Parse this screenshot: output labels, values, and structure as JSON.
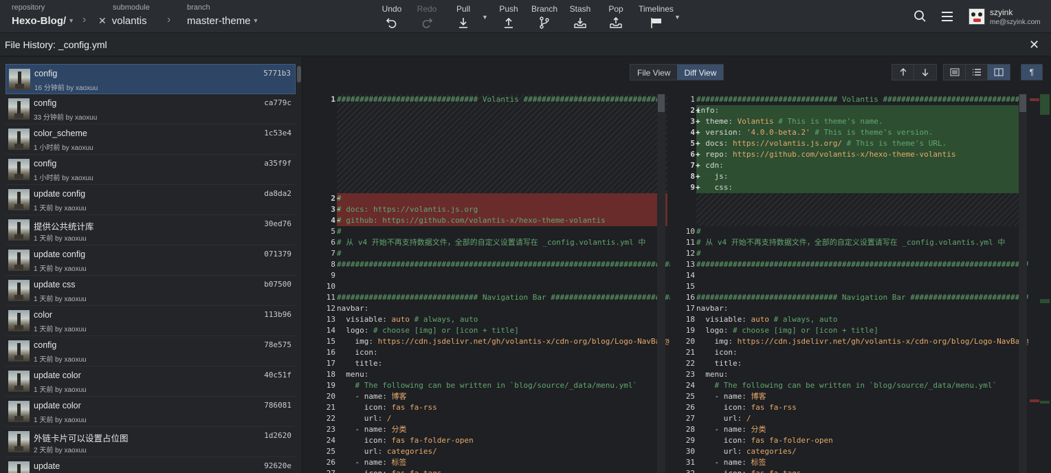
{
  "toolbar": {
    "repository": {
      "label": "repository",
      "value": "Hexo-Blog/"
    },
    "submodule": {
      "label": "submodule",
      "value": "volantis"
    },
    "branch": {
      "label": "branch",
      "value": "master-theme"
    },
    "actions": {
      "undo": "Undo",
      "redo": "Redo",
      "pull": "Pull",
      "push": "Push",
      "branch": "Branch",
      "stash": "Stash",
      "pop": "Pop",
      "timelines": "Timelines"
    },
    "user": {
      "name": "szyink",
      "email": "me@szyink.com"
    }
  },
  "file_history": {
    "title": "File History: _config.yml",
    "close_icon": "close-icon"
  },
  "commits": [
    {
      "message": "config",
      "meta": "16 分钟前 by xaoxuu",
      "sha": "5771b3",
      "selected": true
    },
    {
      "message": "config",
      "meta": "33 分钟前 by xaoxuu",
      "sha": "ca779c"
    },
    {
      "message": "color_scheme",
      "meta": "1 小时前 by xaoxuu",
      "sha": "1c53e4"
    },
    {
      "message": "config",
      "meta": "1 小时前 by xaoxuu",
      "sha": "a35f9f"
    },
    {
      "message": "update config",
      "meta": "1 天前 by xaoxuu",
      "sha": "da8da2"
    },
    {
      "message": "提供公共统计库",
      "meta": "1 天前 by xaoxuu",
      "sha": "30ed76"
    },
    {
      "message": "update config",
      "meta": "1 天前 by xaoxuu",
      "sha": "071379"
    },
    {
      "message": "update css",
      "meta": "1 天前 by xaoxuu",
      "sha": "b07500"
    },
    {
      "message": "color",
      "meta": "1 天前 by xaoxuu",
      "sha": "113b96"
    },
    {
      "message": "config",
      "meta": "1 天前 by xaoxuu",
      "sha": "78e575"
    },
    {
      "message": "update color",
      "meta": "1 天前 by xaoxuu",
      "sha": "40c51f"
    },
    {
      "message": "update color",
      "meta": "1 天前 by xaoxuu",
      "sha": "786081"
    },
    {
      "message": "外链卡片可以设置占位图",
      "meta": "2 天前 by xaoxuu",
      "sha": "1d2620"
    },
    {
      "message": "update",
      "meta": "",
      "sha": "92620e"
    }
  ],
  "diff": {
    "view_toggle": {
      "file_view": "File View",
      "diff_view": "Diff View"
    },
    "left": [
      {
        "ln": "1",
        "code": "############################### Volantis ###############################",
        "cls": "c-c",
        "bold": true
      },
      {
        "ln": "2",
        "mark": "-",
        "code": "#",
        "cls": "c-c",
        "type": "del"
      },
      {
        "ln": "3",
        "mark": "-",
        "code": "# docs: https://volantis.js.org",
        "cls": "c-c",
        "type": "del"
      },
      {
        "ln": "4",
        "mark": "-",
        "code": "# github: https://github.com/volantis-x/hexo-theme-volantis",
        "cls": "c-c",
        "type": "del"
      },
      {
        "ln": "5",
        "code": "#",
        "cls": "c-c"
      },
      {
        "ln": "6",
        "code": "# 从 v4 开始不再支持数据文件，全部的自定义设置请写在 _config.volantis.yml 中",
        "cls": "c-c"
      },
      {
        "ln": "7",
        "code": "#",
        "cls": "c-c"
      },
      {
        "ln": "8",
        "code": "##########################################################################",
        "cls": "c-c"
      },
      {
        "ln": "9",
        "code": ""
      },
      {
        "ln": "10",
        "code": ""
      },
      {
        "ln": "11",
        "code": "############################### Navigation Bar ###############################",
        "cls": "c-c"
      },
      {
        "ln": "12",
        "key": "navbar",
        "code": ":"
      },
      {
        "ln": "13",
        "key": "  visiable",
        "code": ": ",
        "val": "auto",
        "cm": " # always, auto"
      },
      {
        "ln": "14",
        "key": "  logo",
        "code": ": ",
        "cm": "# choose [img] or [icon + title]"
      },
      {
        "ln": "15",
        "key": "    img",
        "code": ": ",
        "val": "https://cdn.jsdelivr.net/gh/volantis-x/cdn-org/blog/Logo-NavBar@"
      },
      {
        "ln": "16",
        "key": "    icon",
        "code": ":"
      },
      {
        "ln": "17",
        "key": "    title",
        "code": ":"
      },
      {
        "ln": "18",
        "key": "  menu",
        "code": ":"
      },
      {
        "ln": "19",
        "code": "    ",
        "cm": "# The following can be written in `blog/source/_data/menu.yml`"
      },
      {
        "ln": "20",
        "key": "    - name",
        "code": ": ",
        "val": "博客"
      },
      {
        "ln": "21",
        "key": "      icon",
        "code": ": ",
        "val": "fas fa-rss"
      },
      {
        "ln": "22",
        "key": "      url",
        "code": ": ",
        "val": "/"
      },
      {
        "ln": "23",
        "key": "    - name",
        "code": ": ",
        "val": "分类"
      },
      {
        "ln": "24",
        "key": "      icon",
        "code": ": ",
        "val": "fas fa-folder-open"
      },
      {
        "ln": "25",
        "key": "      url",
        "code": ": ",
        "val": "categories/"
      },
      {
        "ln": "26",
        "key": "    - name",
        "code": ": ",
        "val": "标签"
      },
      {
        "ln": "27",
        "key": "      icon",
        "code": ": ",
        "val": "fas fa-tags"
      }
    ],
    "right": [
      {
        "ln": "1",
        "code": "############################### Volantis ###############################",
        "cls": "c-c"
      },
      {
        "ln": "2",
        "mark": "+",
        "key": "info",
        "code": ":",
        "type": "add"
      },
      {
        "ln": "3",
        "mark": "+",
        "key": "  theme",
        "code": ": ",
        "val": "Volantis",
        "cm": " # This is theme's name.",
        "type": "add"
      },
      {
        "ln": "4",
        "mark": "+",
        "key": "  version",
        "code": ": ",
        "val": "'4.0.0-beta.2'",
        "cm": " # This is theme's version.",
        "type": "add"
      },
      {
        "ln": "5",
        "mark": "+",
        "key": "  docs",
        "code": ": ",
        "val": "https://volantis.js.org/",
        "cm": " # This is theme's URL.",
        "type": "add"
      },
      {
        "ln": "6",
        "mark": "+",
        "key": "  repo",
        "code": ": ",
        "val": "https://github.com/volantis-x/hexo-theme-volantis",
        "type": "add"
      },
      {
        "ln": "7",
        "mark": "+",
        "key": "  cdn",
        "code": ":",
        "type": "add"
      },
      {
        "ln": "8",
        "mark": "+",
        "key": "    js",
        "code": ":",
        "type": "add"
      },
      {
        "ln": "9",
        "mark": "+",
        "key": "    css",
        "code": ":",
        "type": "add"
      },
      {
        "ln": "10",
        "code": "#",
        "cls": "c-c"
      },
      {
        "ln": "11",
        "code": "# 从 v4 开始不再支持数据文件，全部的自定义设置请写在 _config.volantis.yml 中",
        "cls": "c-c"
      },
      {
        "ln": "12",
        "code": "#",
        "cls": "c-c"
      },
      {
        "ln": "13",
        "code": "##########################################################################",
        "cls": "c-c"
      },
      {
        "ln": "14",
        "code": ""
      },
      {
        "ln": "15",
        "code": ""
      },
      {
        "ln": "16",
        "code": "############################### Navigation Bar ###############################",
        "cls": "c-c"
      },
      {
        "ln": "17",
        "key": "navbar",
        "code": ":"
      },
      {
        "ln": "18",
        "key": "  visiable",
        "code": ": ",
        "val": "auto",
        "cm": " # always, auto"
      },
      {
        "ln": "19",
        "key": "  logo",
        "code": ": ",
        "cm": "# choose [img] or [icon + title]"
      },
      {
        "ln": "20",
        "key": "    img",
        "code": ": ",
        "val": "https://cdn.jsdelivr.net/gh/volantis-x/cdn-org/blog/Logo-NavBar@"
      },
      {
        "ln": "21",
        "key": "    icon",
        "code": ":"
      },
      {
        "ln": "22",
        "key": "    title",
        "code": ":"
      },
      {
        "ln": "23",
        "key": "  menu",
        "code": ":"
      },
      {
        "ln": "24",
        "code": "    ",
        "cm": "# The following can be written in `blog/source/_data/menu.yml`"
      },
      {
        "ln": "25",
        "key": "    - name",
        "code": ": ",
        "val": "博客"
      },
      {
        "ln": "26",
        "key": "      icon",
        "code": ": ",
        "val": "fas fa-rss"
      },
      {
        "ln": "27",
        "key": "      url",
        "code": ": ",
        "val": "/"
      },
      {
        "ln": "28",
        "key": "    - name",
        "code": ": ",
        "val": "分类"
      },
      {
        "ln": "29",
        "key": "      icon",
        "code": ": ",
        "val": "fas fa-folder-open"
      },
      {
        "ln": "30",
        "key": "      url",
        "code": ": ",
        "val": "categories/"
      },
      {
        "ln": "31",
        "key": "    - name",
        "code": ": ",
        "val": "标签"
      },
      {
        "ln": "32",
        "key": "      icon",
        "code": ": ",
        "val": "fas fa-tags"
      }
    ]
  },
  "colors": {
    "accent": "#3a4e6a",
    "added": "#2d4e31",
    "removed": "#6a2b2b",
    "comment": "#62a66e"
  }
}
